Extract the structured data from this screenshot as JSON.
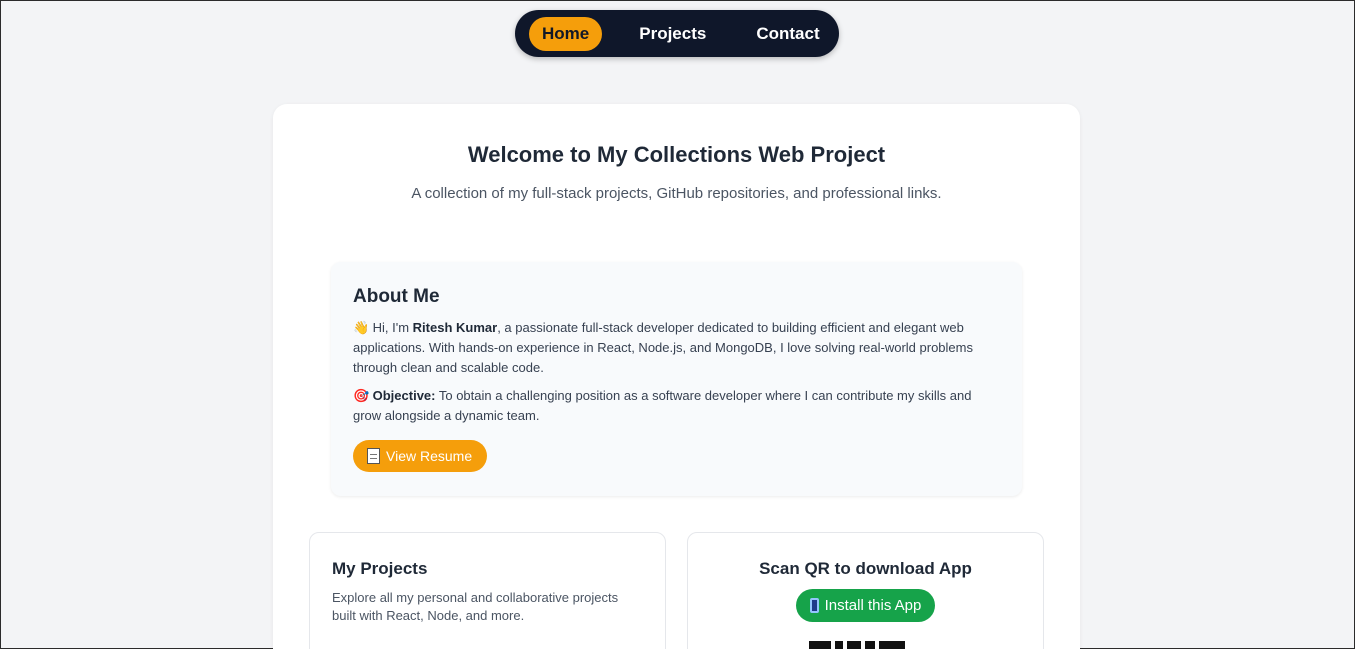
{
  "nav": {
    "items": [
      {
        "label": "Home",
        "active": true
      },
      {
        "label": "Projects",
        "active": false
      },
      {
        "label": "Contact",
        "active": false
      }
    ]
  },
  "hero": {
    "title": "Welcome to My Collections Web Project",
    "subtitle": "A collection of my full-stack projects, GitHub repositories, and professional links."
  },
  "about": {
    "heading": "About Me",
    "intro_emoji": "👋",
    "intro_prefix": "Hi, I'm ",
    "name": "Ritesh Kumar",
    "intro_rest": ", a passionate full-stack developer dedicated to building efficient and elegant web applications. With hands-on experience in React, Node.js, and MongoDB, I love solving real-world problems through clean and scalable code.",
    "objective_emoji": "🎯",
    "objective_label": "Objective:",
    "objective_text": " To obtain a challenging position as a software developer where I can contribute my skills and grow alongside a dynamic team.",
    "resume_button": "View Resume"
  },
  "projects_card": {
    "title": "My Projects",
    "description": "Explore all my personal and collaborative projects built with React, Node, and more."
  },
  "qr_card": {
    "title": "Scan QR to download App",
    "install_button": "Install this App"
  },
  "colors": {
    "accent": "#f59e0b",
    "nav_bg": "#0f172a",
    "install": "#16a34a"
  }
}
